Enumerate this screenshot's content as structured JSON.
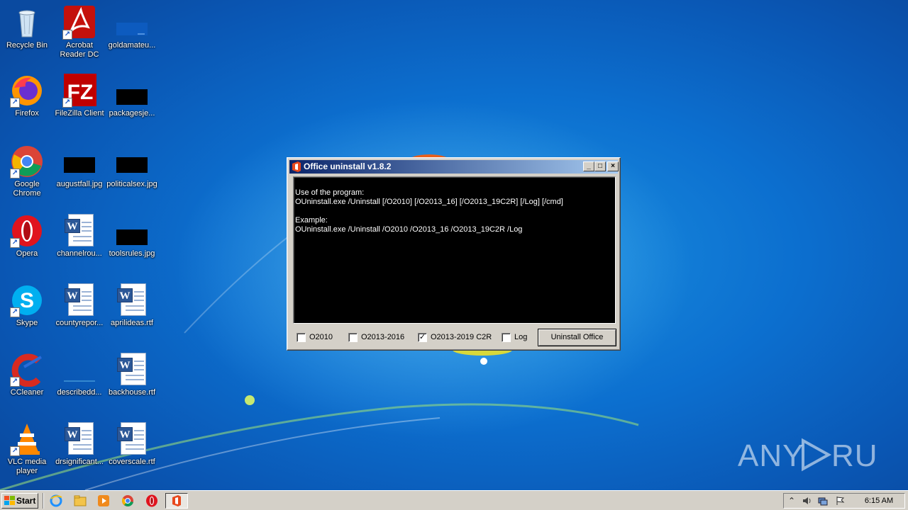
{
  "desktop": {
    "icons": [
      {
        "label": "Recycle Bin",
        "icon": "recycle-bin-icon"
      },
      {
        "label": "Acrobat Reader DC",
        "icon": "acrobat-reader-icon"
      },
      {
        "label": "goldamateu...",
        "icon": "image-file-icon"
      },
      {
        "label": "Firefox",
        "icon": "firefox-icon"
      },
      {
        "label": "FileZilla Client",
        "icon": "filezilla-icon"
      },
      {
        "label": "packagesje...",
        "icon": "image-file-icon"
      },
      {
        "label": "Google Chrome",
        "icon": "chrome-icon"
      },
      {
        "label": "augustfall.jpg",
        "icon": "image-file-icon"
      },
      {
        "label": "politicalsex.jpg",
        "icon": "image-file-icon"
      },
      {
        "label": "Opera",
        "icon": "opera-icon"
      },
      {
        "label": "channelrou...",
        "icon": "word-doc-icon"
      },
      {
        "label": "toolsrules.jpg",
        "icon": "image-file-icon"
      },
      {
        "label": "Skype",
        "icon": "skype-icon"
      },
      {
        "label": "countyrepor...",
        "icon": "word-doc-icon"
      },
      {
        "label": "aprilideas.rtf",
        "icon": "word-doc-icon"
      },
      {
        "label": "CCleaner",
        "icon": "ccleaner-icon"
      },
      {
        "label": "describedd...",
        "icon": "image-file-icon"
      },
      {
        "label": "backhouse.rtf",
        "icon": "word-doc-icon"
      },
      {
        "label": "VLC media player",
        "icon": "vlc-icon"
      },
      {
        "label": "drsignificant...",
        "icon": "word-doc-icon"
      },
      {
        "label": "coverscale.rtf",
        "icon": "word-doc-icon"
      }
    ]
  },
  "window": {
    "title": "Office uninstall v1.8.2",
    "minimize": "_",
    "maximize": "□",
    "close": "×",
    "output_lines": [
      "Use of the program:",
      "OUninstall.exe /Uninstall [/O2010] [/O2013_16] [/O2013_19C2R] [/Log] [/cmd]",
      "",
      "Example:",
      "OUninstall.exe /Uninstall /O2010 /O2013_16 /O2013_19C2R /Log"
    ],
    "options": [
      {
        "label": "O2010",
        "checked": false
      },
      {
        "label": "O2013-2016",
        "checked": false
      },
      {
        "label": "O2013-2019 C2R",
        "checked": true
      },
      {
        "label": "Log",
        "checked": false
      }
    ],
    "uninstall_button": "Uninstall Office"
  },
  "watermark": "ANY RUN",
  "taskbar": {
    "start_label": "Start",
    "clock": "6:15 AM",
    "tray_expand": "⌃"
  }
}
